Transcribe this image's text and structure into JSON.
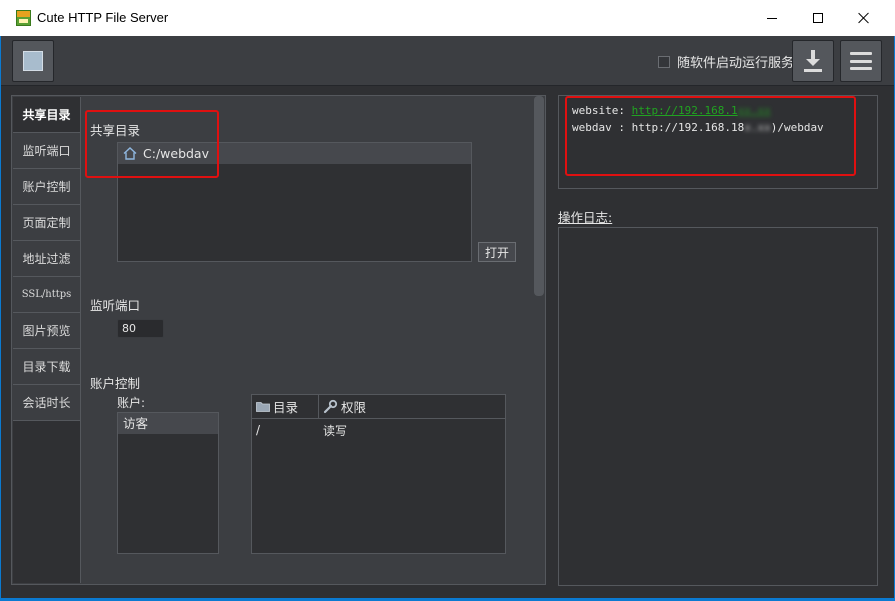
{
  "window": {
    "title": "Cute HTTP File Server",
    "controls": {
      "minimize": "minimize",
      "maximize": "maximize",
      "close": "close"
    }
  },
  "toolbar": {
    "autostart_label": "随软件启动运行服务",
    "autostart_checked": false,
    "icons": [
      "square-icon",
      "download-icon",
      "menu-icon"
    ]
  },
  "sidebar": {
    "items": [
      {
        "label": "共享目录",
        "active": true
      },
      {
        "label": "监听端口",
        "active": false
      },
      {
        "label": "账户控制",
        "active": false
      },
      {
        "label": "页面定制",
        "active": false
      },
      {
        "label": "地址过滤",
        "active": false
      },
      {
        "label": "SSL/https",
        "active": false
      },
      {
        "label": "图片预览",
        "active": false
      },
      {
        "label": "目录下载",
        "active": false
      },
      {
        "label": "会话时长",
        "active": false
      }
    ]
  },
  "share": {
    "title": "共享目录",
    "items": [
      {
        "path": "C:/webdav"
      }
    ],
    "open_button": "打开"
  },
  "port": {
    "title": "监听端口",
    "value": "80"
  },
  "accounts": {
    "title": "账户控制",
    "label": "账户:",
    "items": [
      "访客"
    ],
    "table": {
      "headers": [
        "目录",
        "权限"
      ],
      "rows": [
        {
          "dir": "/",
          "perm": "读写"
        }
      ]
    }
  },
  "urls": {
    "website_label": "website:",
    "website_url": "http://192.168.1",
    "website_redacted": "xx.xx",
    "webdav_label": "webdav :",
    "webdav_url_prefix": "http://192.168.18",
    "webdav_redacted": "x.xx",
    "webdav_url_suffix": ")/webdav"
  },
  "log": {
    "title": "操作日志:"
  },
  "colors": {
    "annotation": "#e01010",
    "link": "#21a321",
    "panel": "#3c3e42",
    "background": "#2f3033"
  }
}
